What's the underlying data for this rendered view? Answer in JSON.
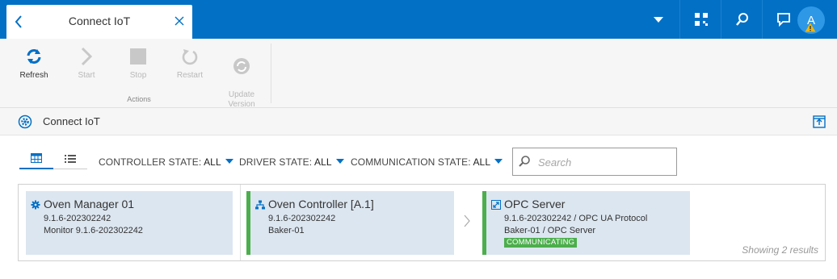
{
  "topbar": {
    "tab_title": "Connect IoT",
    "avatar_initial": "A",
    "accent": "#0270c5"
  },
  "ribbon": {
    "buttons": [
      {
        "label": "Refresh",
        "icon": "refresh-icon",
        "enabled": true
      },
      {
        "label": "Start",
        "icon": "play-icon",
        "enabled": false
      },
      {
        "label": "Stop",
        "icon": "stop-icon",
        "enabled": false
      },
      {
        "label": "Restart",
        "icon": "restart-icon",
        "enabled": false
      },
      {
        "label": "Update\nVersion",
        "icon": "update-version-icon",
        "enabled": false
      }
    ],
    "group_label": "Actions"
  },
  "page": {
    "title": "Connect IoT"
  },
  "filters": {
    "controller_label": "CONTROLLER STATE:",
    "controller_value": "ALL",
    "driver_label": "DRIVER STATE:",
    "driver_value": "ALL",
    "communication_label": "COMMUNICATION STATE:",
    "communication_value": "ALL",
    "search_placeholder": "Search"
  },
  "cards": {
    "manager": {
      "title": "Oven Manager 01",
      "line1": "9.1.6-202302242",
      "line2": "Monitor 9.1.6-202302242"
    },
    "controller": {
      "title": "Oven Controller [A.1]",
      "line1": "9.1.6-202302242",
      "line2": "Baker-01"
    },
    "driver": {
      "title": "OPC Server",
      "line1": "9.1.6-202302242  /  OPC UA Protocol",
      "line2": "Baker-01  /  OPC Server",
      "status": "COMMUNICATING",
      "status_color": "#4cae4c"
    }
  },
  "results_text": "Showing 2 results"
}
